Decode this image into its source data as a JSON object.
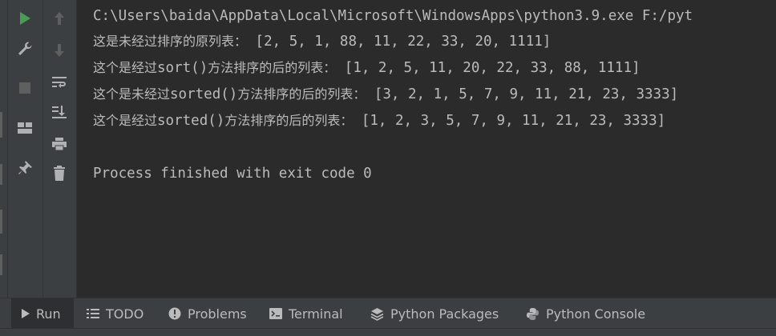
{
  "console": {
    "lines": [
      "C:\\Users\\baida\\AppData\\Local\\Microsoft\\WindowsApps\\python3.9.exe F:/pyt",
      "",
      "",
      "",
      "",
      "",
      "Process finished with exit code 0"
    ],
    "line2_cn": "这是未经过排序的原列表：",
    "line2_val": " [2, 5, 1, 88, 11, 22, 33, 20, 1111]",
    "line3_cn1": "这个是经过",
    "line3_mono": "sort()",
    "line3_cn2": "方法排序的后的列表：",
    "line3_val": " [1, 2, 5, 11, 20, 22, 33, 88, 1111]",
    "line4_cn1": "这个是未经过",
    "line4_mono": "sorted()",
    "line4_cn2": "方法排序的后的列表：",
    "line4_val": " [3, 2, 1, 5, 7, 9, 11, 21, 23, 3333]",
    "line5_cn1": "这个是经过",
    "line5_mono": "sorted()",
    "line5_cn2": "方法排序的后的列表：",
    "line5_val": " [1, 2, 3, 5, 7, 9, 11, 21, 23, 3333]"
  },
  "tabs": {
    "run": "Run",
    "todo": "TODO",
    "problems": "Problems",
    "terminal": "Terminal",
    "python_packages": "Python Packages",
    "python_console": "Python Console"
  },
  "colors": {
    "run_green": "#499c54",
    "icon_gray": "#afb1b3",
    "icon_dim": "#5e6060",
    "text": "#bbbbbb",
    "background": "#2b2b2b",
    "panel": "#3c3f41"
  }
}
